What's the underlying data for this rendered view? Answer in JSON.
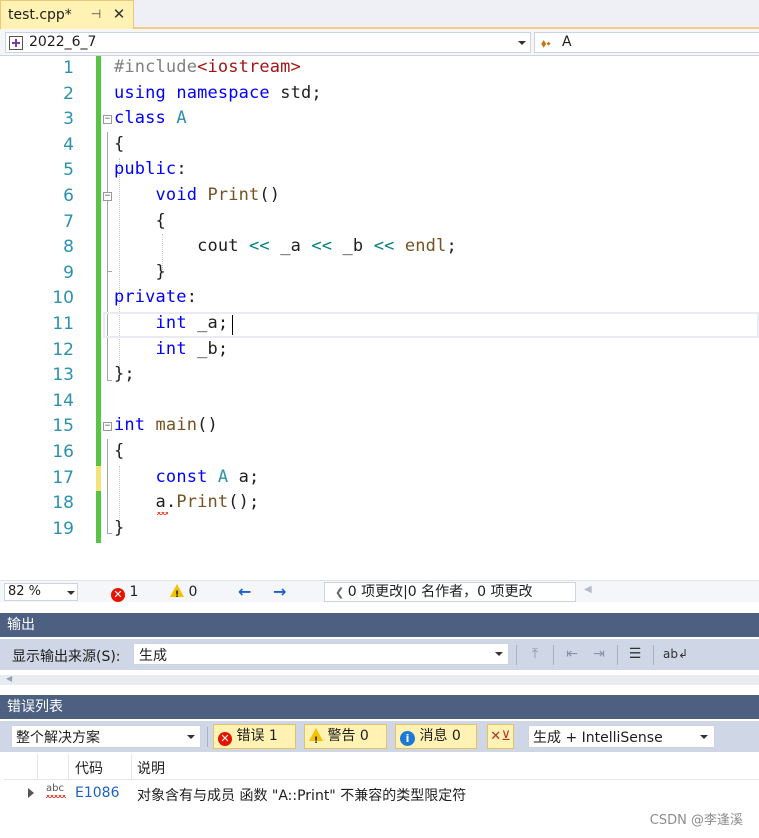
{
  "tab": {
    "name": "test.cpp*",
    "pin_glyph": "⊣",
    "close_glyph": "✕"
  },
  "navbar": {
    "scope": "2022_6_7",
    "member": "A",
    "member_icon": "class-icon"
  },
  "editor": {
    "lines": [
      {
        "n": "1"
      },
      {
        "n": "2"
      },
      {
        "n": "3"
      },
      {
        "n": "4"
      },
      {
        "n": "5"
      },
      {
        "n": "6"
      },
      {
        "n": "7"
      },
      {
        "n": "8"
      },
      {
        "n": "9"
      },
      {
        "n": "10"
      },
      {
        "n": "11"
      },
      {
        "n": "12"
      },
      {
        "n": "13"
      },
      {
        "n": "14"
      },
      {
        "n": "15"
      },
      {
        "n": "16"
      },
      {
        "n": "17"
      },
      {
        "n": "18"
      },
      {
        "n": "19"
      }
    ],
    "code": {
      "l1": {
        "pre": "#include",
        "inc": "<iostream>"
      },
      "l2": {
        "kw1": "using",
        "kw2": "namespace",
        "id": "std;"
      },
      "l3": {
        "kw": "class",
        "ty": "A"
      },
      "l4": {
        "t": "{"
      },
      "l5": {
        "kw": "public",
        "t": ":"
      },
      "l6": {
        "kw": "void",
        "fn": "Print",
        "t": "()"
      },
      "l7": {
        "t": "{"
      },
      "l8": {
        "id": "cout",
        "op1": "<<",
        "a": "_a",
        "op2": "<<",
        "b": "_b",
        "op3": "<<",
        "mac": "endl",
        "t": ";"
      },
      "l9": {
        "t": "}"
      },
      "l10": {
        "kw": "private",
        "t": ":"
      },
      "l11": {
        "kw": "int",
        "id": "_a;"
      },
      "l12": {
        "kw": "int",
        "id": "_b;"
      },
      "l13": {
        "t": "};"
      },
      "l15": {
        "kw": "int",
        "fn": "main",
        "t": "()"
      },
      "l16": {
        "t": "{"
      },
      "l17": {
        "kw": "const",
        "ty": "A",
        "id": "a;"
      },
      "l18": {
        "a": "a",
        "dot": ".",
        "fn": "Print",
        "t": "();"
      },
      "l19": {
        "t": "}"
      }
    }
  },
  "status": {
    "zoom": "82 %",
    "errors": "1",
    "warnings": "0",
    "back_glyph": "←",
    "forward_glyph": "→",
    "codelens": "0 项更改|0 名作者，0 项更改"
  },
  "output": {
    "title": "输出",
    "source_label": "显示输出来源(S):",
    "source_value": "生成"
  },
  "errorlist": {
    "title": "错误列表",
    "scope": "整个解决方案",
    "errors_btn": "错误 1",
    "warnings_btn": "警告 0",
    "messages_btn": "消息 0",
    "build_filter": "生成 + IntelliSense",
    "columns": {
      "code": "代码",
      "desc": "说明"
    },
    "rows": [
      {
        "icon": "abc",
        "code": "E1086",
        "desc": "对象含有与成员 函数 \"A::Print\" 不兼容的类型限定符"
      }
    ]
  },
  "watermark": "CSDN @李逢溪",
  "colors": {
    "keyword": "#0000ff",
    "type": "#2b91af",
    "function": "#74531f",
    "preprocessor": "#808080",
    "include": "#a31515",
    "macro": "#6f008a",
    "operator": "#008080",
    "change_saved": "#57c443",
    "change_unsaved": "#f4e27a",
    "panel_header": "#4d6082",
    "error": "#e51400",
    "warning": "#f5c200",
    "info": "#1c7ad6"
  }
}
